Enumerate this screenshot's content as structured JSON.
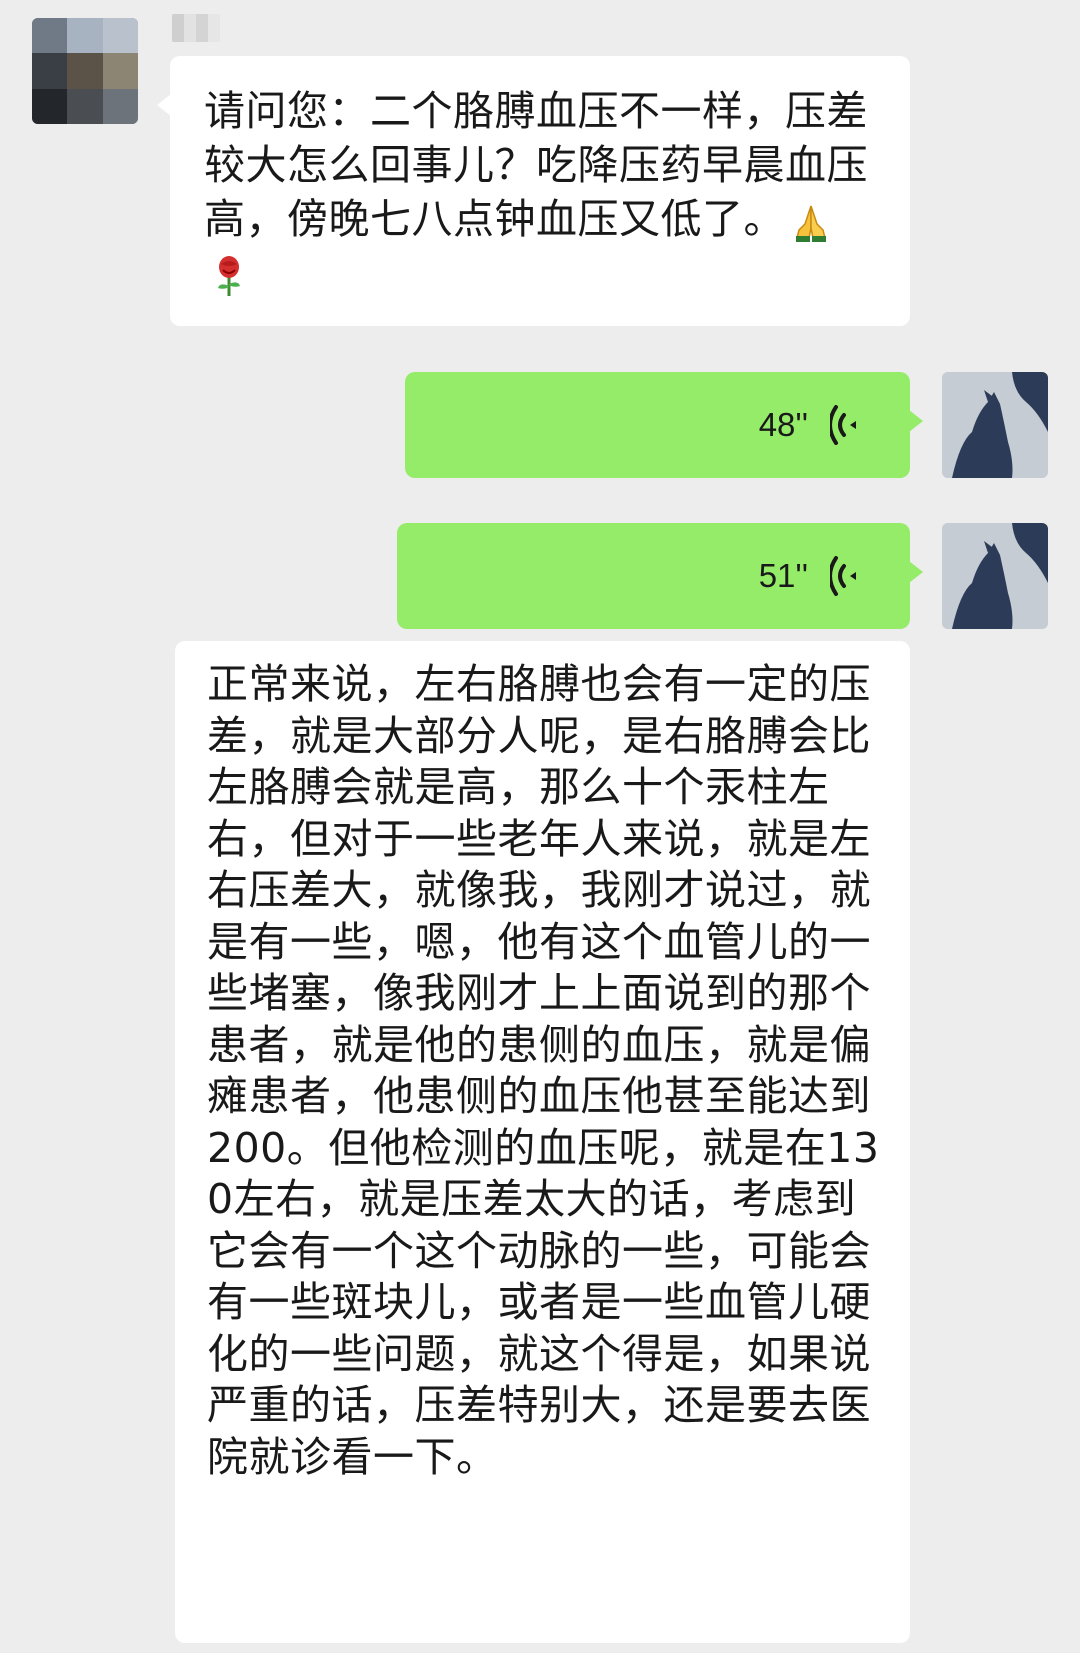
{
  "chat": {
    "contact_name": "",
    "messages": [
      {
        "sender": "contact",
        "type": "text",
        "text": "请问您：二个胳膊血压不一样，压差较大怎么回事儿？吃降压药早晨血压高，傍晚七八点钟血压又低了。",
        "emojis": [
          "folded-hands-emoji",
          "rose-emoji"
        ]
      },
      {
        "sender": "me",
        "type": "voice",
        "duration": "48''"
      },
      {
        "sender": "me",
        "type": "voice",
        "duration": "51''"
      },
      {
        "sender": "contact",
        "type": "text",
        "text": "正常来说，左右胳膊也会有一定的压差，就是大部分人呢，是右胳膊会比左胳膊会就是高，那么十个汞柱左右，但对于一些老年人来说，就是左右压差大，就像我，我刚才说过，就是有一些，嗯，他有这个血管儿的一些堵塞，像我刚才上上面说到的那个患者，就是他的患侧的血压，就是偏瘫患者，他患侧的血压他甚至能达到200。但他检测的血压呢，就是在130左右，就是压差太大的话，考虑到它会有一个这个动脉的一些，可能会有一些斑块儿，或者是一些血管儿硬化的一些问题，就这个得是，如果说严重的话，压差特别大，还是要去医院就诊看一下。"
      }
    ]
  },
  "colors": {
    "background": "#ededed",
    "incoming_bubble": "#ffffff",
    "outgoing_bubble": "#95ec69",
    "text": "#191919"
  }
}
